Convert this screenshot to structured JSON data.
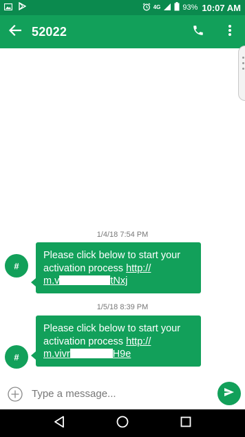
{
  "status_bar": {
    "network_label": "4G",
    "battery_percent": "93%",
    "time": "10:07 AM"
  },
  "conversation": {
    "title": "52022"
  },
  "messages": [
    {
      "timestamp": "1/4/18 7:54 PM",
      "avatar": "#",
      "text": "Please click below to start your activation process ",
      "link_start": "http://",
      "link_visible_1": "m.v",
      "link_visible_2": "tNxj"
    },
    {
      "timestamp": "1/5/18 8:39 PM",
      "avatar": "#",
      "text": "Please click below to start your activation process ",
      "link_start": "http://",
      "link_visible_1": "m.vivr",
      "link_visible_2": "H9e"
    }
  ],
  "compose": {
    "placeholder": "Type a message..."
  },
  "icons": {
    "back": "arrow-left-icon",
    "call": "phone-icon",
    "menu": "more-vert-icon",
    "add": "add-circle-icon",
    "send": "send-icon"
  },
  "colors": {
    "status_bar": "#0b8a4e",
    "app_bar": "#12a05a",
    "bubble": "#12a05a"
  }
}
